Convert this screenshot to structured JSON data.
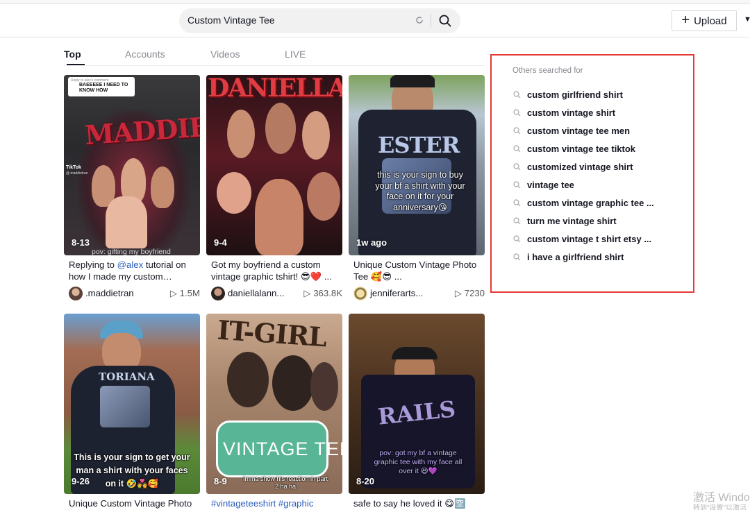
{
  "search": {
    "value": "Custom Vintage Tee"
  },
  "header": {
    "upload_label": "Upload"
  },
  "tabs": [
    {
      "label": "Top",
      "active": true
    },
    {
      "label": "Accounts",
      "active": false
    },
    {
      "label": "Videos",
      "active": false
    },
    {
      "label": "LIVE",
      "active": false
    }
  ],
  "videos": [
    {
      "date": "8-13",
      "desc_prefix": "Replying to ",
      "desc_link": "@alex",
      "desc_rest": " tutorial on how I made my custom…",
      "author": ".maddietran",
      "views": "1.5M",
      "overlay": {
        "reply_to": "Reply to alex's comment",
        "reply_text": "BAEEEEE I NEED TO KNOW HOW",
        "title_art": "MADDIE",
        "app_mark": "TikTok",
        "handle": "@.maddietran",
        "caption": "pov: gifting my boyfriend"
      }
    },
    {
      "date": "9-4",
      "desc": "Got my boyfriend a custom vintage graphic tshirt! 😎❤️ ...",
      "author": "daniellalann...",
      "views": "363.8K",
      "overlay": {
        "title_art": "DANIELLA"
      }
    },
    {
      "date": "1w ago",
      "desc": "Unique Custom Vintage Photo Tee 🥰😎 ...",
      "author": "jenniferarts...",
      "views": "7230",
      "overlay": {
        "title_art": "ESTER",
        "caption": "this is your sign to buy your bf a shirt with your face on it for your anniversary😘"
      }
    },
    {
      "date": "9-26",
      "desc": "Unique Custom Vintage Photo",
      "overlay": {
        "title_art": "TORIANA",
        "caption": "This is your sign to get your man a shirt with your faces on it 🤣💑🥰"
      }
    },
    {
      "date": "8-9",
      "desc": "#vintageteeshirt #graphic",
      "overlay": {
        "title_art": "IT-GIRL",
        "banner": "VINTAGE TEE",
        "caption": "Imma show his reaction in part 2 ha ha"
      }
    },
    {
      "date": "8-20",
      "desc": "safe to say he loved it 😋🈳",
      "overlay": {
        "title_art": "RAILS",
        "caption": "pov: got my bf a vintage graphic tee with my face all over it 😆💜"
      }
    }
  ],
  "suggestions": {
    "heading": "Others searched for",
    "items": [
      "custom girlfriend shirt",
      "custom vintage shirt",
      "custom vintage tee men",
      "custom vintage tee tiktok",
      "customized vintage shirt",
      "vintage tee",
      "custom vintage graphic tee ...",
      "turn me vintage shirt",
      "custom vintage t shirt etsy ...",
      "i have a girlfriend shirt"
    ]
  },
  "watermark": {
    "line1": "激活 Windo",
    "line2": "转到\"设置\"以激活"
  },
  "colors": {
    "accent_link": "#2b5db9",
    "highlight_border": "#e53935",
    "muted_text": "#8a8b91"
  }
}
